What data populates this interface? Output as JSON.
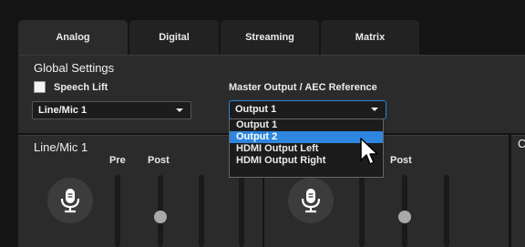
{
  "tabs": [
    {
      "label": "Analog"
    },
    {
      "label": "Digital"
    },
    {
      "label": "Streaming"
    },
    {
      "label": "Matrix"
    }
  ],
  "global": {
    "title": "Global Settings",
    "speech_lift_label": "Speech Lift",
    "speech_lift_checked": false,
    "input_select_value": "Line/Mic 1",
    "master_label": "Master Output / AEC Reference",
    "master_select_value": "Output 1",
    "dropdown_options": [
      "Output 1",
      "Output 2",
      "HDMI Output Left",
      "HDMI Output Right"
    ],
    "dropdown_highlighted": "Output 2"
  },
  "channels": [
    {
      "title": "Line/Mic 1",
      "pre_label": "Pre",
      "post_label": "Post"
    },
    {
      "title": "",
      "pre_label": "",
      "post_label": "Post"
    },
    {
      "title": "C"
    }
  ],
  "colors": {
    "accent": "#2e86de",
    "panel": "#2b2b2b",
    "background": "#141414"
  },
  "icons": [
    "microphone-icon",
    "mouse-pointer-icon",
    "chevron-down-icon"
  ]
}
